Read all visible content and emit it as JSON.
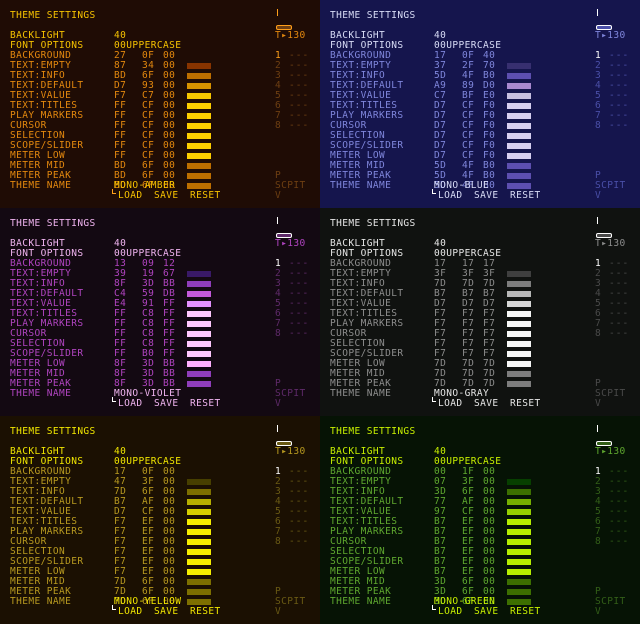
{
  "labels": {
    "title": "THEME SETTINGS",
    "params": [
      "BACKLIGHT",
      "FONT OPTIONS",
      "BACKGROUND",
      "TEXT:EMPTY",
      "TEXT:INFO",
      "TEXT:DEFAULT",
      "TEXT:VALUE",
      "TEXT:TITLES",
      "PLAY MARKERS",
      "CURSOR",
      "SELECTION",
      "SCOPE/SLIDER",
      "METER LOW",
      "METER MID",
      "METER PEAK",
      "THEME NAME"
    ],
    "backlight_value": "40",
    "font_value": "00UPPERCASE",
    "actions": [
      "LOAD",
      "SAVE",
      "RESET"
    ],
    "tempo": "T▸130",
    "track_numbers": [
      "1",
      "2",
      "3",
      "4",
      "5",
      "6",
      "7",
      "8"
    ],
    "track_dash": "---",
    "side_p": "P",
    "side_scpit": "SCPIT",
    "side_v": "V"
  },
  "panels": [
    {
      "name": "MONO-AMBER",
      "bg": "#1f0c05",
      "text": "#e3880e",
      "accent": "#ff9f1a",
      "dim": "#6e3f12",
      "bright": "#f6c200",
      "colors": [
        [
          "27",
          "0F",
          "00"
        ],
        [
          "87",
          "34",
          "00"
        ],
        [
          "BD",
          "6F",
          "00"
        ],
        [
          "D7",
          "93",
          "00"
        ],
        [
          "F7",
          "C7",
          "00"
        ],
        [
          "FF",
          "CF",
          "00"
        ],
        [
          "FF",
          "CF",
          "00"
        ],
        [
          "FF",
          "CF",
          "00"
        ],
        [
          "FF",
          "CF",
          "00"
        ],
        [
          "FF",
          "CF",
          "00"
        ],
        [
          "FF",
          "CF",
          "00"
        ],
        [
          "BD",
          "6F",
          "00"
        ],
        [
          "BD",
          "6F",
          "00"
        ],
        [
          "BD",
          "6F",
          "00"
        ]
      ],
      "swatches": [
        null,
        "#873400",
        "#bd6f00",
        "#d79300",
        "#f7c700",
        "#ffcf00",
        "#ffcf00",
        "#ffcf00",
        "#ffcf00",
        "#ffcf00",
        "#ffcf00",
        "#bd6f00",
        "#bd6f00",
        "#bd6f00"
      ]
    },
    {
      "name": "MONO-BLUE",
      "bg": "#15154d",
      "text": "#7f86dc",
      "accent": "#ffffff",
      "dim": "#4a4fa8",
      "bright": "#d8dcf6",
      "colors": [
        [
          "17",
          "0F",
          "40"
        ],
        [
          "37",
          "2F",
          "70"
        ],
        [
          "5D",
          "4F",
          "B0"
        ],
        [
          "A9",
          "89",
          "D0"
        ],
        [
          "C7",
          "BF",
          "E0"
        ],
        [
          "D7",
          "CF",
          "F0"
        ],
        [
          "D7",
          "CF",
          "F0"
        ],
        [
          "D7",
          "CF",
          "F0"
        ],
        [
          "D7",
          "CF",
          "F0"
        ],
        [
          "D7",
          "CF",
          "F0"
        ],
        [
          "D7",
          "CF",
          "F0"
        ],
        [
          "5D",
          "4F",
          "B0"
        ],
        [
          "5D",
          "4F",
          "B0"
        ],
        [
          "5D",
          "4F",
          "B0"
        ]
      ],
      "swatches": [
        null,
        "#372f70",
        "#5d4fb0",
        "#a989d0",
        "#c7bfe0",
        "#d7cff0",
        "#d7cff0",
        "#d7cff0",
        "#d7cff0",
        "#d7cff0",
        "#d7cff0",
        "#5d4fb0",
        "#5d4fb0",
        "#5d4fb0"
      ]
    },
    {
      "name": "MONO-VIOLET",
      "bg": "#130912",
      "text": "#b044c0",
      "accent": "#ffffff",
      "dim": "#5f2a6a",
      "bright": "#f0b4f0",
      "colors": [
        [
          "13",
          "09",
          "12"
        ],
        [
          "39",
          "19",
          "67"
        ],
        [
          "8F",
          "3D",
          "BB"
        ],
        [
          "C4",
          "59",
          "DB"
        ],
        [
          "E4",
          "91",
          "FF"
        ],
        [
          "FF",
          "C8",
          "FF"
        ],
        [
          "FF",
          "C8",
          "FF"
        ],
        [
          "FF",
          "C8",
          "FF"
        ],
        [
          "FF",
          "C8",
          "FF"
        ],
        [
          "FF",
          "B0",
          "FF"
        ],
        [
          "8F",
          "3D",
          "BB"
        ],
        [
          "8F",
          "3D",
          "BB"
        ],
        [
          "8F",
          "3D",
          "BB"
        ]
      ],
      "swatches": [
        null,
        "#391967",
        "#8f3dbb",
        "#c459db",
        "#e491ff",
        "#ffc8ff",
        "#ffc8ff",
        "#ffc8ff",
        "#ffc8ff",
        "#ffc8ff",
        "#ffb0ff",
        "#8f3dbb",
        "#8f3dbb",
        "#8f3dbb"
      ]
    },
    {
      "name": "MONO-GRAY",
      "bg": "#101210",
      "text": "#8d8d8d",
      "accent": "#ffffff",
      "dim": "#4a4a4a",
      "bright": "#e6e6e6",
      "colors": [
        [
          "17",
          "17",
          "17"
        ],
        [
          "3F",
          "3F",
          "3F"
        ],
        [
          "7D",
          "7D",
          "7D"
        ],
        [
          "B7",
          "B7",
          "B7"
        ],
        [
          "D7",
          "D7",
          "D7"
        ],
        [
          "F7",
          "F7",
          "F7"
        ],
        [
          "F7",
          "F7",
          "F7"
        ],
        [
          "F7",
          "F7",
          "F7"
        ],
        [
          "F7",
          "F7",
          "F7"
        ],
        [
          "F7",
          "F7",
          "F7"
        ],
        [
          "7D",
          "7D",
          "7D"
        ],
        [
          "7D",
          "7D",
          "7D"
        ],
        [
          "7D",
          "7D",
          "7D"
        ]
      ],
      "swatches": [
        null,
        "#3f3f3f",
        "#7d7d7d",
        "#b7b7b7",
        "#d7d7d7",
        "#f7f7f7",
        "#f7f7f7",
        "#f7f7f7",
        "#f7f7f7",
        "#f7f7f7",
        "#f7f7f7",
        "#7d7d7d",
        "#7d7d7d",
        "#7d7d7d"
      ]
    },
    {
      "name": "MONO-YELLOW",
      "bg": "#1b1002",
      "text": "#b89a20",
      "accent": "#ffffff",
      "dim": "#6a5a14",
      "bright": "#f1e600",
      "colors": [
        [
          "17",
          "0F",
          "00"
        ],
        [
          "47",
          "3F",
          "00"
        ],
        [
          "7D",
          "6F",
          "00"
        ],
        [
          "B7",
          "AF",
          "00"
        ],
        [
          "D7",
          "CF",
          "00"
        ],
        [
          "F7",
          "EF",
          "00"
        ],
        [
          "F7",
          "EF",
          "00"
        ],
        [
          "F7",
          "EF",
          "00"
        ],
        [
          "F7",
          "EF",
          "00"
        ],
        [
          "F7",
          "EF",
          "00"
        ],
        [
          "F7",
          "EF",
          "00"
        ],
        [
          "7D",
          "6F",
          "00"
        ],
        [
          "7D",
          "6F",
          "00"
        ],
        [
          "7D",
          "6F",
          "00"
        ]
      ],
      "swatches": [
        null,
        "#473f00",
        "#7d6f00",
        "#b7af00",
        "#d7cf00",
        "#f7ef00",
        "#f7ef00",
        "#f7ef00",
        "#f7ef00",
        "#f7ef00",
        "#f7ef00",
        "#7d6f00",
        "#7d6f00",
        "#7d6f00"
      ]
    },
    {
      "name": "MONO-GREEN",
      "bg": "#061305",
      "text": "#5fa82f",
      "accent": "#ffffff",
      "dim": "#335f18",
      "bright": "#c8f000",
      "colors": [
        [
          "00",
          "1F",
          "00"
        ],
        [
          "07",
          "3F",
          "00"
        ],
        [
          "3D",
          "6F",
          "00"
        ],
        [
          "77",
          "AF",
          "00"
        ],
        [
          "97",
          "CF",
          "00"
        ],
        [
          "B7",
          "EF",
          "00"
        ],
        [
          "B7",
          "EF",
          "00"
        ],
        [
          "B7",
          "EF",
          "00"
        ],
        [
          "B7",
          "EF",
          "00"
        ],
        [
          "B7",
          "EF",
          "00"
        ],
        [
          "B7",
          "EF",
          "00"
        ],
        [
          "3D",
          "6F",
          "00"
        ],
        [
          "3D",
          "6F",
          "00"
        ],
        [
          "3D",
          "6F",
          "00"
        ]
      ],
      "swatches": [
        null,
        "#073f00",
        "#3d6f00",
        "#77af00",
        "#97cf00",
        "#b7ef00",
        "#b7ef00",
        "#b7ef00",
        "#b7ef00",
        "#b7ef00",
        "#b7ef00",
        "#3d6f00",
        "#3d6f00",
        "#3d6f00"
      ]
    }
  ]
}
